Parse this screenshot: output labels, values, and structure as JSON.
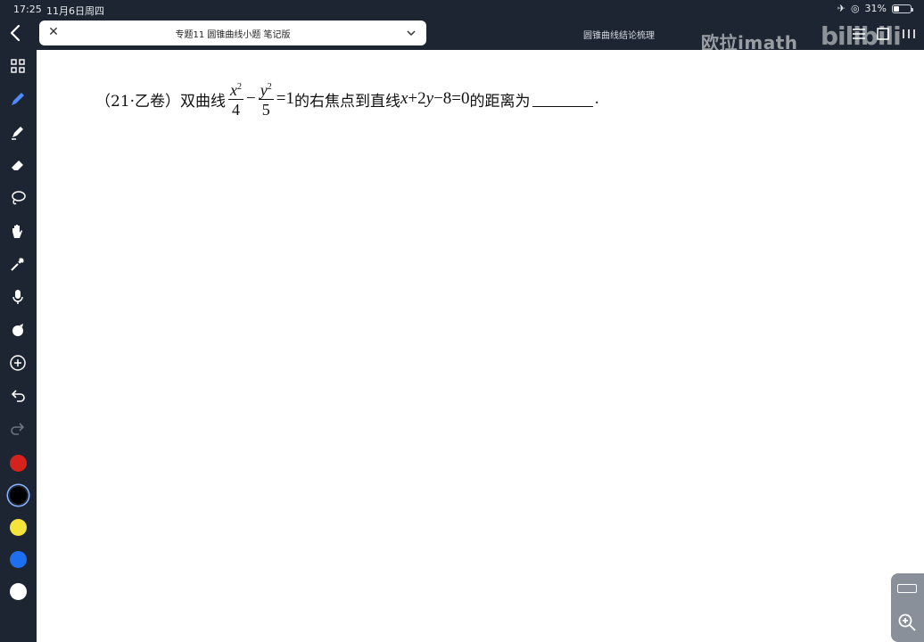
{
  "status": {
    "time": "17:25",
    "date": "11月6日周四",
    "battery": "31%",
    "battery_level": 0.31
  },
  "doc": {
    "title": "专题11 圆锥曲线小题 笔记版",
    "other_tab": "圆锥曲线结论梳理"
  },
  "watermark": {
    "channel": "欧拉imath",
    "platform": "bilibili"
  },
  "problem": {
    "source": "（21·乙卷）",
    "text_a": "双曲线",
    "frac1_num": "x",
    "frac1_den": "4",
    "minus": "−",
    "frac2_num": "y",
    "frac2_den": "5",
    "eq_one": "=1",
    "text_b": "的右焦点到直线",
    "line_eq_x": "x",
    "line_eq_mid": "+2",
    "line_eq_y": "y",
    "line_eq_end": "−8=0",
    "text_c": "的距离为",
    "period": "."
  },
  "toolbar": {
    "tools": [
      "back-icon",
      "grid-icon",
      "pen-icon",
      "highlighter-icon",
      "eraser-icon",
      "lasso-icon",
      "hand-icon",
      "eyedropper-icon",
      "mic-icon",
      "shape-icon",
      "add-icon",
      "undo-icon",
      "redo-icon"
    ],
    "colors": [
      "#d6221c",
      "#000000",
      "#f5e43a",
      "#1e6ff0",
      "#ffffff"
    ]
  }
}
